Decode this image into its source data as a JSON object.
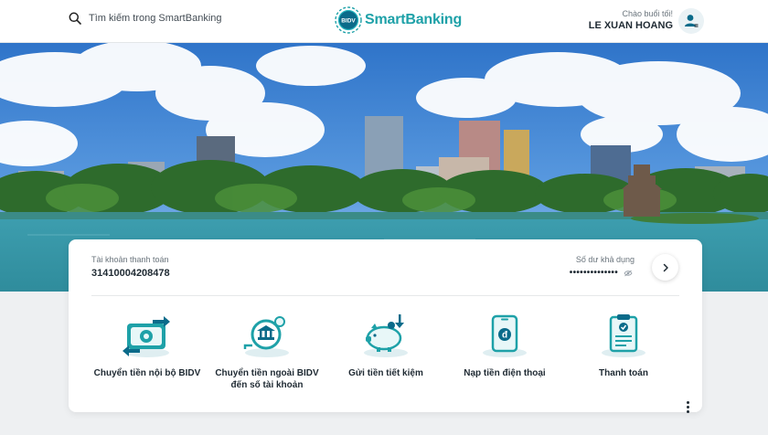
{
  "header": {
    "search_placeholder": "Tìm kiếm trong SmartBanking",
    "logo_badge": "BIDV",
    "logo_text": "SmartBanking",
    "greeting": "Chào buổi tối!",
    "user_name": "LE XUAN HOANG"
  },
  "account": {
    "label": "Tài khoản thanh toán",
    "number": "31410004208478",
    "balance_label": "Số dư khả dụng",
    "balance_masked": "••••••••••••••"
  },
  "actions": [
    {
      "label": "Chuyển tiền nội bộ BIDV",
      "icon": "internal-transfer-icon"
    },
    {
      "label": "Chuyển tiền ngoài BIDV đến số tài khoản",
      "icon": "external-transfer-icon"
    },
    {
      "label": "Gửi tiền tiết kiệm",
      "icon": "piggy-bank-icon"
    },
    {
      "label": "Nạp tiền điện thoại",
      "icon": "phone-topup-icon"
    },
    {
      "label": "Thanh toán",
      "icon": "bill-payment-icon"
    }
  ],
  "colors": {
    "brand": "#1ea1a8",
    "brand_dark": "#0b6b8a",
    "text": "#1f2a33",
    "muted": "#6b757d"
  }
}
